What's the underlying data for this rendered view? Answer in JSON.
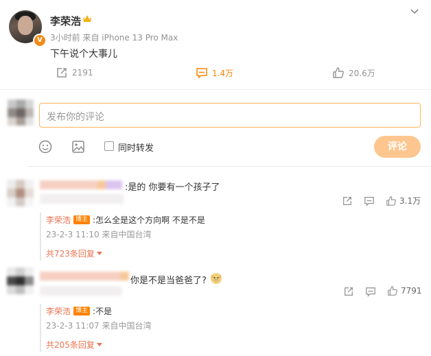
{
  "post": {
    "username": "李荣浩",
    "time": "3小时前",
    "source": "来自 iPhone 13 Pro Max",
    "text": "下午说个大事儿",
    "verified_badge": "V",
    "icons": {
      "menu": "chevron-down-icon",
      "crown": "crown-icon"
    }
  },
  "actions": {
    "repost_count": "2191",
    "comment_count": "1.4万",
    "like_count": "20.6万"
  },
  "composer": {
    "placeholder": "发布你的评论",
    "repost_label": "同时转发",
    "submit_label": "评论",
    "icons": [
      "emoji-icon",
      "image-icon"
    ]
  },
  "comments": [
    {
      "text": ":是的 你要有一个孩子了",
      "like_count": "3.1万",
      "reply": {
        "name": "李荣浩",
        "tag": "博主",
        "text": ":怎么全是这个方向啊 不是不是",
        "time": "23-2-3 11:10",
        "source": "来自中国台湾"
      },
      "more": "共723条回复"
    },
    {
      "text": "你是不是当爸爸了?",
      "emoji": "doge-emoji",
      "like_count": "7791",
      "reply": {
        "name": "李荣浩",
        "tag": "博主",
        "text": ":不是",
        "time": "23-2-3 11:07",
        "source": "来自中国台湾"
      },
      "more": "共205条回复"
    }
  ],
  "colors": {
    "accent": "#ff8200",
    "link": "#eb7350",
    "submit_disabled": "#fdc68f",
    "input_border": "#ffb35a"
  }
}
